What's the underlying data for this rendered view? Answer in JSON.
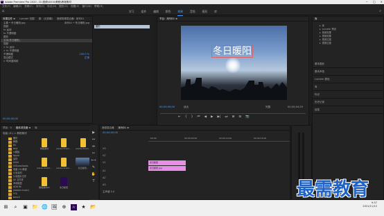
{
  "titlebar": {
    "title": "Adobe Premiere Pro 2020 - D:\\视频\\0000\\教程\\教程素材",
    "logo": "Pr"
  },
  "menu": [
    "文件(F)",
    "编辑(E)",
    "剪辑(C)",
    "序列(S)",
    "标记(M)",
    "图形(G)",
    "视图(V)",
    "窗口(W)",
    "帮助(H)"
  ],
  "workspaces": {
    "tabs": [
      "学习",
      "组件",
      "编辑",
      "颜色",
      "效果",
      "音频",
      "图形",
      "库"
    ],
    "active_index": 4
  },
  "effect_controls": {
    "tabs": [
      "效果控件 ≡",
      "Lumetri 范围",
      "源：(无剪辑)",
      "音频剪辑混合器：序列01"
    ],
    "source_label": "主要 * 冬日暖阳.jpg",
    "sequence_label": "序列01 * 冬日暖阳.jpg",
    "mini_clip": "图形",
    "rows": [
      {
        "label": "视频",
        "value": ""
      },
      {
        "label": "fx 运动",
        "value": ""
      },
      {
        "label": "fx 不透明度",
        "value": ""
      },
      {
        "label": "图形",
        "value": ""
      },
      {
        "label": "文本(冬日暖阳)",
        "value": ""
      },
      {
        "label": "视频",
        "value": ""
      },
      {
        "label": "> fx 运动",
        "value": ""
      },
      {
        "label": "> fx 不透明度",
        "value": ""
      },
      {
        "label": "不透明度",
        "value": "100.0 %"
      },
      {
        "label": "混合模式",
        "value": "正常"
      },
      {
        "label": "> 时间重映射",
        "value": ""
      }
    ],
    "timecode": "00;00;00;00"
  },
  "program_monitor": {
    "header": "节目：序列01 ≡",
    "overlay_text": "冬日暖阳",
    "timecode_in": "00;00;00;00",
    "fit_label": "适合",
    "quality_label": "完整",
    "timecode_out": "00;00;04;29",
    "controls": [
      "⇤",
      "{",
      "}",
      "⏮",
      "◀",
      "▶",
      "▶|",
      "⏭",
      "⊞",
      "⊟",
      "📷"
    ]
  },
  "libraries": {
    "header": "库",
    "items": [
      "库",
      "Lumetri 预设",
      "音频效果",
      "视频效果",
      "视频过渡",
      "视频过渡"
    ],
    "sections": [
      "基本图形",
      "基本声音",
      "Lumetri 颜色",
      "库",
      "标记",
      "历史记录",
      "信息"
    ]
  },
  "project": {
    "tabs": [
      "项目：0",
      "媒体浏览器 ≡",
      "库"
    ],
    "path": "电脑 (H:) > 教程素材",
    "tree": [
      "备份",
      "教程",
      "fill",
      "test",
      "in模板",
      "Apple",
      "素材",
      "0000",
      "00Downloads",
      "电脑 (H:)教程",
      "小米素材",
      "小米图片文件",
      "00 文件夹",
      "本地磁盘",
      "ADB Rk",
      "(Adobe music)",
      "FY0",
      "bench",
      "1ElEye"
    ],
    "thumbs": [
      "教程素材",
      "Adobe Premi...",
      "Adobe Premi...",
      "Adobe Premi...",
      "Adobe Premi...",
      "冬日暖阳...",
      "教程素材01",
      "冬日暖阳"
    ]
  },
  "tools": [
    "▶",
    "↔",
    "⇹",
    "✂",
    "⟷",
    "✎",
    "✋",
    "T"
  ],
  "timeline": {
    "tabs": [
      "音频混合器",
      "序列01 ≡"
    ],
    "timecode": "00;00;00;00",
    "tracks": [
      "V3",
      "V2",
      "V1",
      "A1",
      "A2",
      "A3",
      "主声道"
    ],
    "ruler_labels": [
      ":00:00",
      "00;00;05;00",
      "00;00;10;00",
      "00;00;15;00"
    ],
    "clip_video": "冬日暖阳",
    "clip_image": "冬日暖阳.jpg",
    "master_value": "0.0"
  },
  "taskbar": {
    "icons": [
      "⊞",
      "⌕",
      "▣",
      "📁",
      "🌐",
      "🖼",
      "⊕",
      "Pr",
      "★",
      "📂"
    ],
    "time": "9:37",
    "date": "2021/11/12"
  },
  "watermark": "最需教育"
}
